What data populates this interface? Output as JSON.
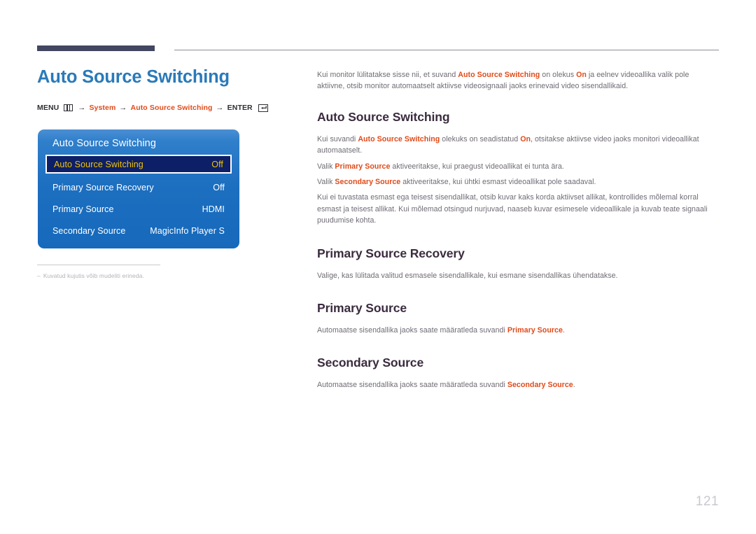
{
  "document": {
    "page_number": "121",
    "title": "Auto Source Switching"
  },
  "menu_path": {
    "menu_label": "MENU",
    "menu_icon": "menu-grid-icon",
    "arrow": "→",
    "step1": "System",
    "step2": "Auto Source Switching",
    "enter_label": "ENTER",
    "enter_icon": "enter-return-icon"
  },
  "osd": {
    "title": "Auto Source Switching",
    "rows": [
      {
        "label": "Auto Source Switching",
        "value": "Off",
        "selected": true
      },
      {
        "label": "Primary Source Recovery",
        "value": "Off",
        "selected": false
      },
      {
        "label": "Primary Source",
        "value": "HDMI",
        "selected": false
      },
      {
        "label": "Secondary Source",
        "value": "MagicInfo Player S",
        "selected": false
      }
    ]
  },
  "footnote": {
    "dash": "–",
    "text": "Kuvatud kujutis võib mudeliti erineda."
  },
  "intro": {
    "p1_a": "Kui monitor lülitatakse sisse nii, et suvand ",
    "p1_b": "Auto Source Switching",
    "p1_c": " on olekus ",
    "p1_d": "On",
    "p1_e": " ja eelnev videoallika valik pole aktiivne, otsib monitor automaatselt aktiivse videosignaali jaoks erinevaid video sisendallikaid."
  },
  "sections": [
    {
      "heading": "Auto Source Switching",
      "paragraphs": [
        {
          "parts": [
            {
              "t": "Kui suvandi ",
              "b": false
            },
            {
              "t": "Auto Source Switching",
              "b": true
            },
            {
              "t": " olekuks on seadistatud ",
              "b": false
            },
            {
              "t": "On",
              "b": true
            },
            {
              "t": ", otsitakse aktiivse video jaoks monitori videoallikat automaatselt.",
              "b": false
            }
          ]
        },
        {
          "parts": [
            {
              "t": "Valik ",
              "b": false
            },
            {
              "t": "Primary Source",
              "b": true
            },
            {
              "t": " aktiveeritakse, kui praegust videoallikat ei tunta ära.",
              "b": false
            }
          ]
        },
        {
          "parts": [
            {
              "t": "Valik ",
              "b": false
            },
            {
              "t": "Secondary Source",
              "b": true
            },
            {
              "t": " aktiveeritakse, kui ühtki esmast videoallikat pole saadaval.",
              "b": false
            }
          ]
        },
        {
          "parts": [
            {
              "t": "Kui ei tuvastata esmast ega teisest sisendallikat, otsib kuvar kaks korda aktiivset allikat, kontrollides mõlemal korral esmast ja teisest allikat. Kui mõlemad otsingud nurjuvad, naaseb kuvar esimesele videoallikale ja kuvab teate signaali puudumise kohta.",
              "b": false
            }
          ]
        }
      ]
    },
    {
      "heading": "Primary Source Recovery",
      "paragraphs": [
        {
          "parts": [
            {
              "t": "Valige, kas lülitada valitud esmasele sisendallikale, kui esmane sisendallikas ühendatakse.",
              "b": false
            }
          ]
        }
      ]
    },
    {
      "heading": "Primary Source",
      "paragraphs": [
        {
          "parts": [
            {
              "t": "Automaatse sisendallika jaoks saate määratleda suvandi ",
              "b": false
            },
            {
              "t": "Primary Source",
              "b": true
            },
            {
              "t": ".",
              "b": false
            }
          ]
        }
      ]
    },
    {
      "heading": "Secondary Source",
      "paragraphs": [
        {
          "parts": [
            {
              "t": "Automaatse sisendallika jaoks saate määratleda suvandi ",
              "b": false
            },
            {
              "t": "Secondary Source",
              "b": true
            },
            {
              "t": ".",
              "b": false
            }
          ]
        }
      ]
    }
  ],
  "colors": {
    "title_blue": "#2a7ab9",
    "accent_orange": "#e04a19",
    "heading_dark": "#3b2b3f",
    "body_gray": "#6f6b74",
    "osd_blue": "#1d6fc0",
    "osd_selected_bg": "#0d1f66",
    "osd_selected_text": "#f2c400",
    "rule_dark": "#434660",
    "page_number_gray": "#c8c8d2"
  }
}
